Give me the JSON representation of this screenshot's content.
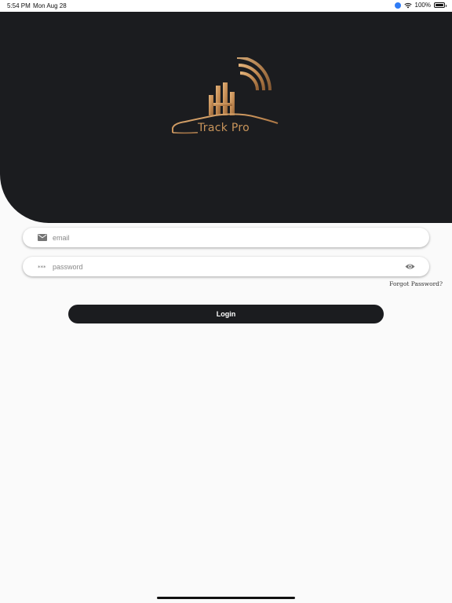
{
  "status_bar": {
    "time": "5:54 PM",
    "date": "Mon Aug 28",
    "battery": "100%"
  },
  "brand": {
    "logo_text": "Track Pro",
    "logo_color": "#c9955b",
    "header_color": "#1b1c1f"
  },
  "login_form": {
    "email_placeholder": "email",
    "email_icon": "mail-icon",
    "password_placeholder": "password",
    "password_icon": "password-dots-icon",
    "visibility_icon": "eye-icon",
    "forgot_label": "Forgot Password?",
    "login_label": "Login"
  }
}
